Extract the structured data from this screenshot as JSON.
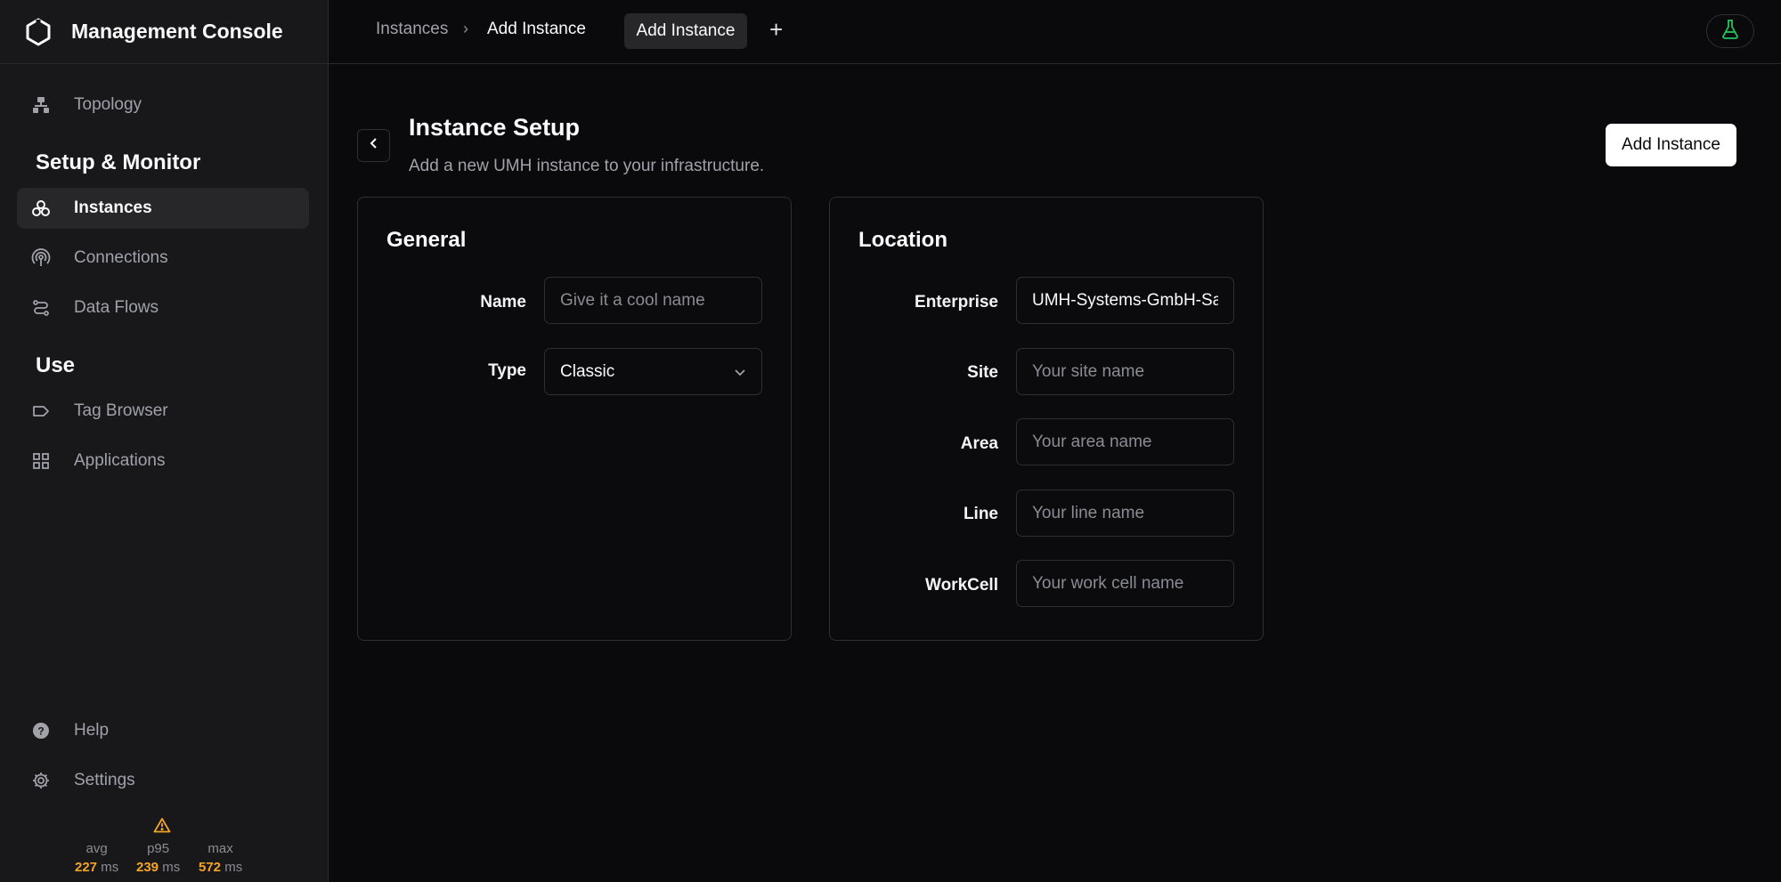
{
  "app": {
    "title": "Management Console"
  },
  "sidebar": {
    "items": [
      {
        "label": "Topology",
        "icon": "topology-icon"
      },
      {
        "label": "Instances",
        "icon": "instances-icon",
        "active": true
      },
      {
        "label": "Connections",
        "icon": "connections-icon"
      },
      {
        "label": "Data Flows",
        "icon": "data-flows-icon"
      },
      {
        "label": "Tag Browser",
        "icon": "tag-icon"
      },
      {
        "label": "Applications",
        "icon": "grid-icon"
      },
      {
        "label": "Help",
        "icon": "help-icon"
      },
      {
        "label": "Settings",
        "icon": "gear-icon"
      }
    ],
    "sections": {
      "setup": "Setup & Monitor",
      "use": "Use"
    },
    "latency": {
      "avg_label": "avg",
      "avg_value": "227",
      "p95_label": "p95",
      "p95_value": "239",
      "max_label": "max",
      "max_value": "572",
      "unit": "ms"
    }
  },
  "topbar": {
    "breadcrumb": [
      "Instances",
      "Add Instance"
    ],
    "active_tab": "Add Instance",
    "add_tab": "+"
  },
  "main": {
    "title": "Instance Setup",
    "subtitle": "Add a new UMH instance to your infrastructure.",
    "primary_button": "Add Instance",
    "general": {
      "title": "General",
      "name_label": "Name",
      "name_placeholder": "Give it a cool name",
      "type_label": "Type",
      "type_value": "Classic"
    },
    "location": {
      "title": "Location",
      "enterprise_label": "Enterprise",
      "enterprise_value": "UMH-Systems-GmbH-Sa",
      "site_label": "Site",
      "site_placeholder": "Your site name",
      "area_label": "Area",
      "area_placeholder": "Your area name",
      "line_label": "Line",
      "line_placeholder": "Your line name",
      "workcell_label": "WorkCell",
      "workcell_placeholder": "Your work cell name"
    }
  },
  "colors": {
    "accent_warning": "#f5a524",
    "lab_green": "#22c55e"
  }
}
